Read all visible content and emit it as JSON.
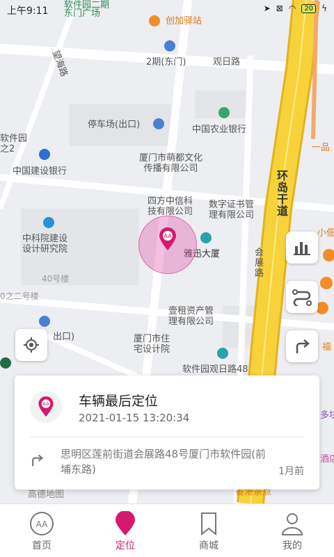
{
  "status_bar": {
    "time": "上午9:11",
    "battery": "20"
  },
  "map": {
    "labels": {
      "ruanjianyuan2qi": "软件园二期",
      "dongmen_guangchang": "东门广场",
      "chuangjia_yizhan": "创加驿站",
      "erqi_dongmen": "2期(东门)",
      "guanri_lu": "观日路",
      "wangxia_lu": "望海路",
      "tingchechang": "停车场(出口)",
      "nongye_bank": "中国农业银行",
      "ruanjianyuan_zhi2": "软件园\n之2",
      "jianshe_bank": "中国建设银行",
      "mengdu": "厦门市萌都文化\n传播有限公司",
      "yipin": "一品",
      "huandao_gandao": "环\n岛\n干\n道",
      "zhongxin": "四方中信科\n技有限公司",
      "shuzizhengshu": "数字证书管\n理有限公司",
      "zhongkeyuan": "中科院建设\n设计研究院",
      "yaxun": "雅迅大厦",
      "huizhan_lu": "会\n展\n路",
      "hao40": "40号楼",
      "zhi2hao": "0之二号楼",
      "yihe": "壹租资产管\n理有限公司",
      "chukou": "出口)",
      "zhuzhai": "厦门市住\n宅设计院",
      "guanri48": "软件园观日路48",
      "xiaofo": "小佃",
      "fu": "福",
      "duojin": "多块",
      "jiudian": "酒店",
      "xianggang": "香港茶点",
      "gaode": "高德地图"
    }
  },
  "card": {
    "title": "车辆最后定位",
    "time": "2021-01-15 13:20:34",
    "address": "思明区莲前街道会展路48号厦门市软件园(前埔东路)",
    "ago": "1月前"
  },
  "nav": {
    "items": [
      {
        "label": "首页",
        "active": false
      },
      {
        "label": "定位",
        "active": true
      },
      {
        "label": "商城",
        "active": false
      },
      {
        "label": "我的",
        "active": false
      }
    ]
  },
  "colors": {
    "accent": "#d6196e",
    "highway": "#f7d23a",
    "road": "#ffffff",
    "map_bg": "#eceef1"
  }
}
